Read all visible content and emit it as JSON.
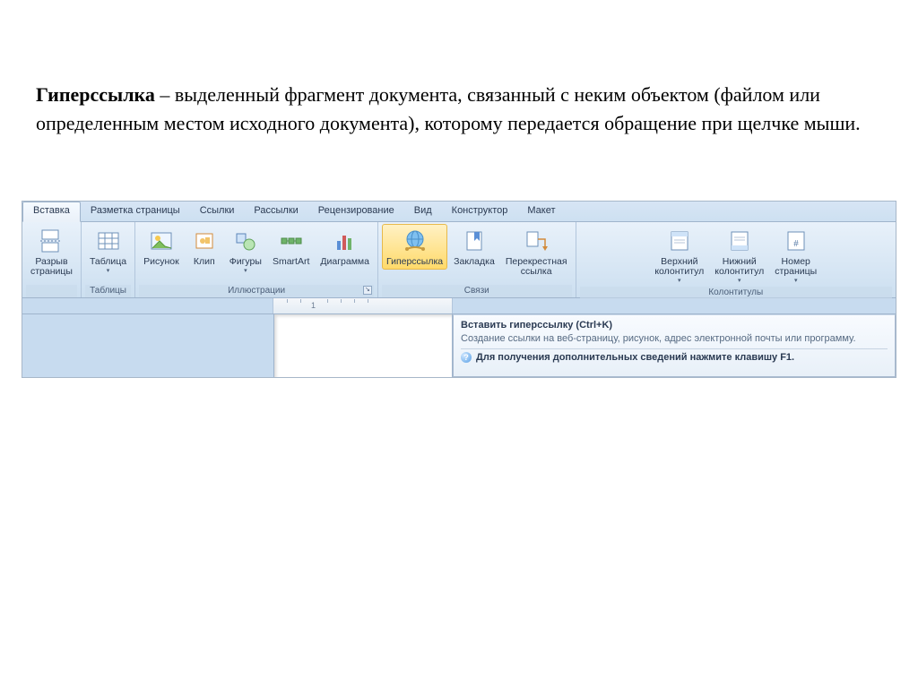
{
  "text": {
    "bold": "Гиперссылка",
    "rest": " – выделенный фрагмент документа, связанный с неким объектом (файлом или определенным местом исходного документа), которому передается обращение при щелчке мыши."
  },
  "tabs": [
    "Вставка",
    "Разметка страницы",
    "Ссылки",
    "Рассылки",
    "Рецензирование",
    "Вид",
    "Конструктор",
    "Макет"
  ],
  "activeTab": 0,
  "groups": {
    "pages": {
      "btn": "Разрыв\nстраницы"
    },
    "tables": {
      "label": "Таблицы",
      "btn": "Таблица"
    },
    "illustrations": {
      "label": "Иллюстрации",
      "btns": [
        "Рисунок",
        "Клип",
        "Фигуры",
        "SmartArt",
        "Диаграмма"
      ]
    },
    "links": {
      "label": "Связи",
      "btns": [
        "Гиперссылка",
        "Закладка",
        "Перекрестная\nссылка"
      ]
    },
    "headerfooter": {
      "label": "Колонтитулы",
      "btns": [
        "Верхний\nколонтитул",
        "Нижний\nколонтитул",
        "Номер\nстраницы"
      ]
    }
  },
  "ruler": {
    "num": "1"
  },
  "tooltip": {
    "title": "Вставить гиперссылку (Ctrl+K)",
    "body": "Создание ссылки на веб-страницу, рисунок, адрес электронной почты или программу.",
    "footer": "Для получения дополнительных сведений нажмите клавишу F1."
  }
}
